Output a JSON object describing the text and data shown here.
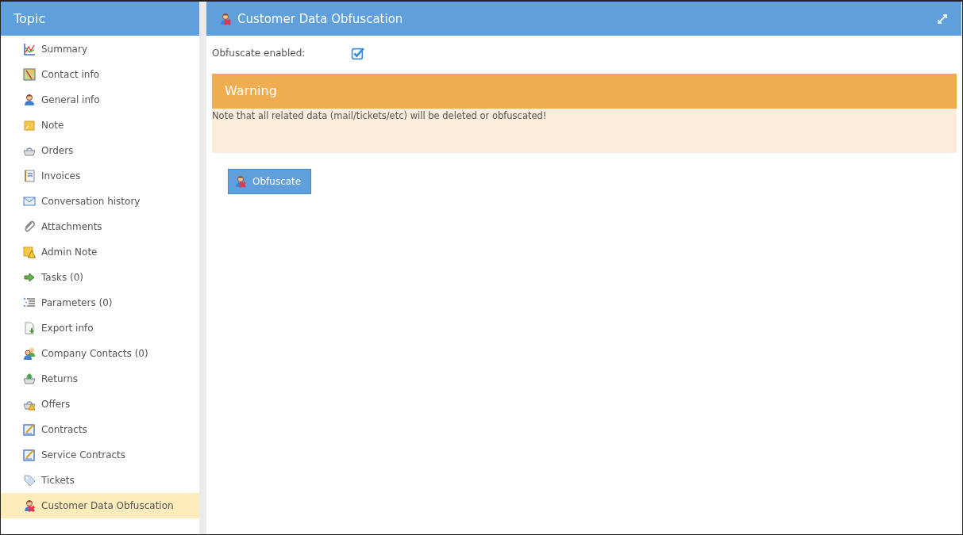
{
  "sidebar": {
    "title": "Topic",
    "items": [
      {
        "label": "Summary",
        "kind": "chart",
        "selected": false
      },
      {
        "label": "Contact info",
        "kind": "map",
        "selected": false
      },
      {
        "label": "General info",
        "kind": "person",
        "selected": false
      },
      {
        "label": "Note",
        "kind": "note",
        "selected": false
      },
      {
        "label": "Orders",
        "kind": "basket",
        "selected": false
      },
      {
        "label": "Invoices",
        "kind": "notebook",
        "selected": false
      },
      {
        "label": "Conversation history",
        "kind": "mail",
        "selected": false
      },
      {
        "label": "Attachments",
        "kind": "clip",
        "selected": false
      },
      {
        "label": "Admin Note",
        "kind": "warnnote",
        "selected": false
      },
      {
        "label": "Tasks (0)",
        "kind": "arrow",
        "selected": false
      },
      {
        "label": "Parameters (0)",
        "kind": "list",
        "selected": false
      },
      {
        "label": "Export info",
        "kind": "export",
        "selected": false
      },
      {
        "label": "Company Contacts (0)",
        "kind": "people",
        "selected": false
      },
      {
        "label": "Returns",
        "kind": "basketup",
        "selected": false
      },
      {
        "label": "Offers",
        "kind": "basketwarn",
        "selected": false
      },
      {
        "label": "Contracts",
        "kind": "contract",
        "selected": false
      },
      {
        "label": "Service Contracts",
        "kind": "contract",
        "selected": false
      },
      {
        "label": "Tickets",
        "kind": "tag",
        "selected": false
      },
      {
        "label": "Customer Data Obfuscation",
        "kind": "obfuscate",
        "selected": true
      }
    ]
  },
  "panel": {
    "title": "Customer Data Obfuscation",
    "field": {
      "label": "Obfuscate enabled:",
      "checked": true
    },
    "warning": {
      "title": "Warning",
      "message": "Note that all related data (mail/tickets/etc) will be deleted or obfuscated!"
    },
    "button": "Obfuscate"
  }
}
